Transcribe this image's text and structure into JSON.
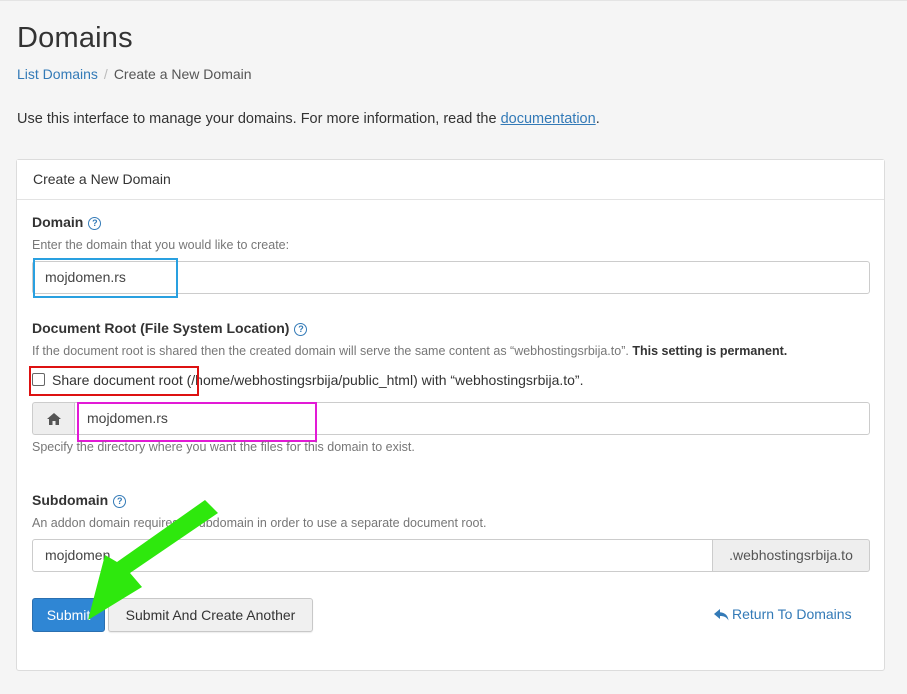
{
  "page": {
    "title": "Domains",
    "breadcrumb": {
      "parent": "List Domains",
      "current": "Create a New Domain"
    },
    "intro_text": "Use this interface to manage your domains. For more information, read the ",
    "intro_link": "documentation",
    "intro_end": "."
  },
  "panel": {
    "heading": "Create a New Domain",
    "domain": {
      "label": "Domain",
      "hint": "Enter the domain that you would like to create:",
      "value": "mojdomen.rs"
    },
    "docroot": {
      "label": "Document Root (File System Location)",
      "hint_text": "If the document root is shared then the created domain will serve the same content as “webhostingsrbija.to”. ",
      "hint_bold": "This setting is permanent.",
      "checkbox_label": "Share document root (/home/webhostingsrbija/public_html) with “webhostingsrbija.to”.",
      "value": "mojdomen.rs",
      "icon": "home-icon",
      "below_hint": "Specify the directory where you want the files for this domain to exist."
    },
    "subdomain": {
      "label": "Subdomain",
      "hint": "An addon domain requires a subdomain in order to use a separate document root.",
      "value": "mojdomen",
      "suffix": ".webhostingsrbija.to"
    },
    "buttons": {
      "submit": "Submit",
      "submit_another": "Submit And Create Another",
      "return_link": "Return To Domains"
    }
  },
  "colors": {
    "accent": "#337ab7",
    "primary_button": "#2f86d4",
    "highlight_blue": "#29a0e0",
    "highlight_red": "#dd1111",
    "highlight_pink": "#e21ad6",
    "arrow_green": "#2ee80d"
  }
}
